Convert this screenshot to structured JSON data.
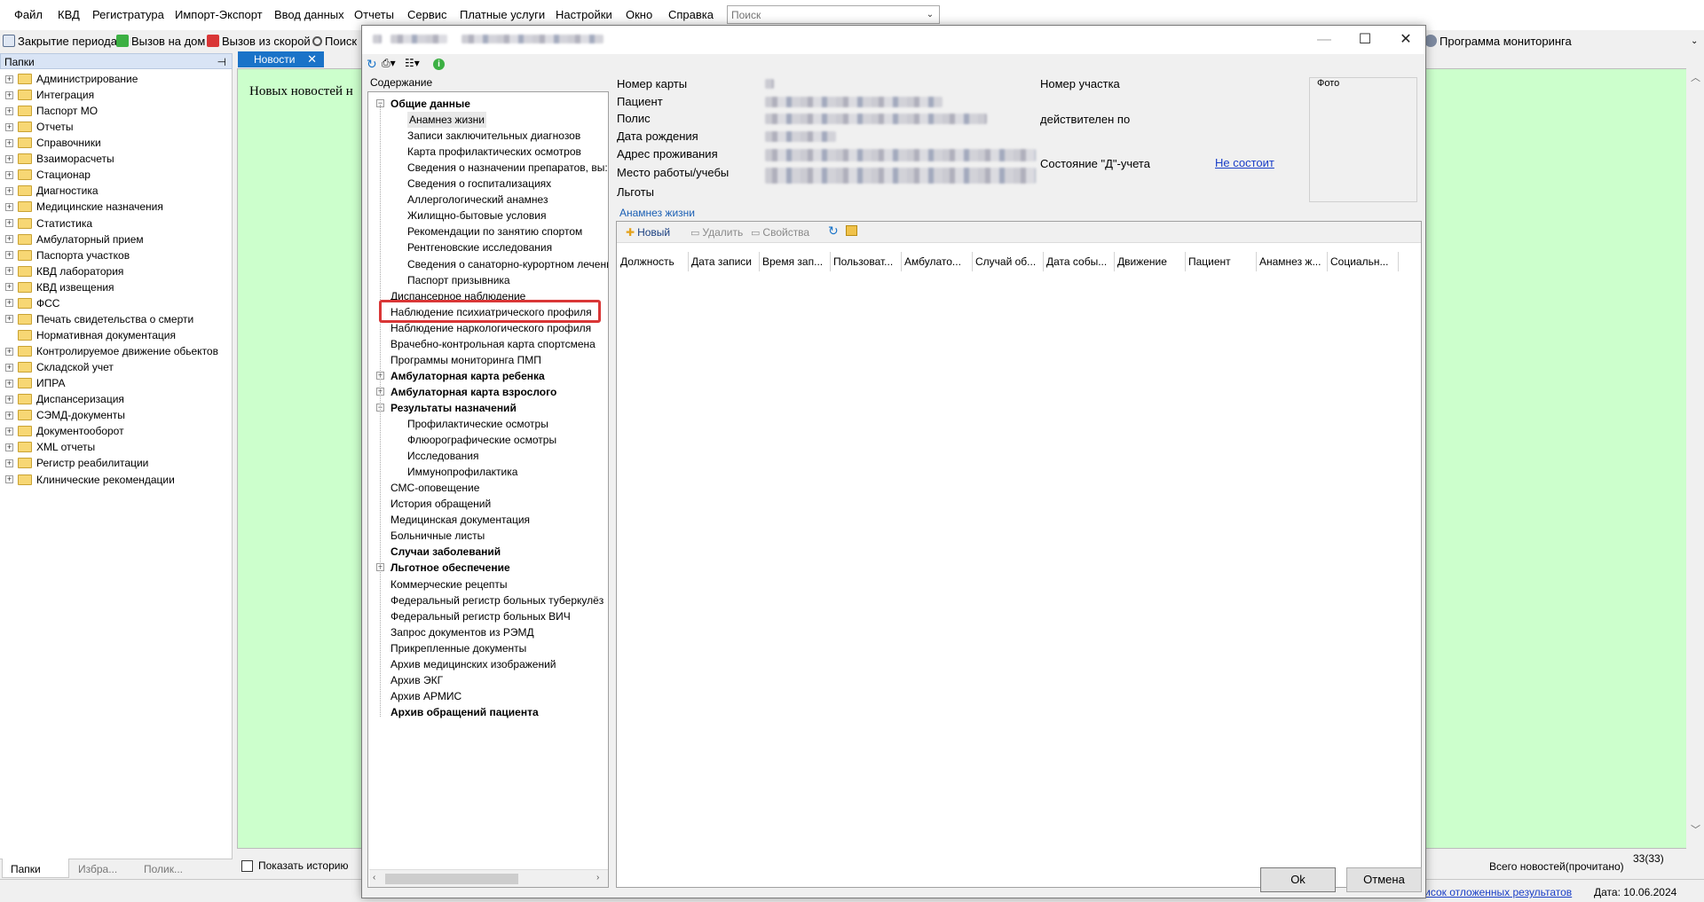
{
  "main_menu": [
    "Файл",
    "КВД",
    "Регистратура",
    "Импорт-Экспорт",
    "Ввод данных",
    "Отчеты",
    "Сервис",
    "Платные услуги",
    "Настройки",
    "Окно",
    "Справка"
  ],
  "search": {
    "placeholder": "Поиск"
  },
  "toolbar": {
    "close_period": "Закрытие периода",
    "home_call": "Вызов на дом",
    "ambulance_call": "Вызов из скорой",
    "search": "Поиск",
    "monitoring_program": "Программа мониторинга"
  },
  "folders": {
    "title": "Папки",
    "items": [
      "Администрирование",
      "Интеграция",
      "Паспорт МО",
      "Отчеты",
      "Справочники",
      "Взаиморасчеты",
      "Стационар",
      "Диагностика",
      "Медицинские назначения",
      "Статистика",
      "Амбулаторный прием",
      "Паспорта участков",
      "КВД лаборатория",
      "КВД извещения",
      "ФСС",
      "Печать свидетельства о смерти",
      "Нормативная документация",
      "Контролируемое движение обьектов",
      "Складской учет",
      "ИПРА",
      "Диспансеризация",
      "СЭМД-документы",
      "Документооборот",
      "XML отчеты",
      "Регистр реабилитации",
      "Клинические рекомендации"
    ]
  },
  "left_tabs": [
    "Папки",
    "Избра...",
    "Полик..."
  ],
  "news": {
    "tab": "Новости",
    "message": "Новых новостей н",
    "show_history": "Показать историю",
    "total": "Всего новостей(прочитано)",
    "count": "33(33)"
  },
  "status": {
    "deferred": "Список отложенных результатов",
    "date": "Дата: 10.06.2024"
  },
  "dialog": {
    "contents_label": "Содержание",
    "tree": [
      {
        "label": "Общие данные",
        "bold": true,
        "level": 0,
        "exp": "−"
      },
      {
        "label": "Анамнез жизни",
        "level": 1,
        "selected": true
      },
      {
        "label": "Записи заключительных диагнозов",
        "level": 1
      },
      {
        "label": "Карта профилактических осмотров",
        "level": 1
      },
      {
        "label": "Сведения о назначении препаратов, вы:",
        "level": 1
      },
      {
        "label": "Сведения о госпитализациях",
        "level": 1
      },
      {
        "label": "Аллергологический анамнез",
        "level": 1
      },
      {
        "label": "Жилищно-бытовые условия",
        "level": 1
      },
      {
        "label": "Рекомендации по занятию спортом",
        "level": 1
      },
      {
        "label": "Рентгеновские исследования",
        "level": 1
      },
      {
        "label": "Сведения о санаторно-курортном лечени",
        "level": 1
      },
      {
        "label": "Паспорт призывника",
        "level": 1
      },
      {
        "label": "Диспансерное наблюдение",
        "level": 0
      },
      {
        "label": "Наблюдение психиатрического профиля",
        "level": 0,
        "highlighted": true
      },
      {
        "label": "Наблюдение наркологического профиля",
        "level": 0
      },
      {
        "label": "Врачебно-контрольная карта спортсмена",
        "level": 0
      },
      {
        "label": "Программы мониторинга ПМП",
        "level": 0
      },
      {
        "label": "Амбулаторная карта ребенка",
        "bold": true,
        "level": 0,
        "exp": "+"
      },
      {
        "label": "Амбулаторная карта взрослого",
        "bold": true,
        "level": 0,
        "exp": "+"
      },
      {
        "label": "Результаты назначений",
        "bold": true,
        "level": 0,
        "exp": "−"
      },
      {
        "label": "Профилактические осмотры",
        "level": 1
      },
      {
        "label": "Флюорографические осмотры",
        "level": 1
      },
      {
        "label": "Исследования",
        "level": 1
      },
      {
        "label": "Иммунопрофилактика",
        "level": 1
      },
      {
        "label": "СМС-оповещение",
        "level": 0
      },
      {
        "label": "История обращений",
        "level": 0
      },
      {
        "label": "Медицинская документация",
        "level": 0
      },
      {
        "label": "Больничные листы",
        "level": 0
      },
      {
        "label": "Случаи заболеваний",
        "bold": true,
        "level": 0
      },
      {
        "label": "Льготное обеспечение",
        "bold": true,
        "level": 0,
        "exp": "+"
      },
      {
        "label": "Коммерческие рецепты",
        "level": 0
      },
      {
        "label": "Федеральный регистр больных туберкулёз",
        "level": 0
      },
      {
        "label": "Федеральный регистр больных ВИЧ",
        "level": 0
      },
      {
        "label": "Запрос документов из РЭМД",
        "level": 0
      },
      {
        "label": "Прикрепленные документы",
        "level": 0
      },
      {
        "label": "Архив медицинских изображений",
        "level": 0
      },
      {
        "label": "Архив ЭКГ",
        "level": 0
      },
      {
        "label": "Архив АРМИС",
        "level": 0
      },
      {
        "label": "Архив обращений пациента",
        "bold": true,
        "level": 0
      }
    ],
    "patient": {
      "card_number": "Номер карты",
      "patient": "Пациент",
      "policy": "Полис",
      "birth_date": "Дата рождения",
      "address": "Адрес проживания",
      "work": "Место работы/учебы",
      "benefits": "Льготы",
      "district_number": "Номер участка",
      "valid_until": "действителен по",
      "d_status_label": "Состояние \"Д\"-учета",
      "d_status_value": "Не состоит",
      "photo": "Фото"
    },
    "section": "Анамнез жизни",
    "grid_toolbar": {
      "new": "Новый",
      "delete": "Удалить",
      "properties": "Свойства"
    },
    "columns": [
      "Должность",
      "Дата записи",
      "Время зап...",
      "Пользоват...",
      "Амбулато...",
      "Случай об...",
      "Дата собы...",
      "Движение",
      "Пациент",
      "Анамнез ж...",
      "Социальн..."
    ],
    "ok": "Ok",
    "cancel": "Отмена"
  },
  "colors": {
    "accent": "#1a73c8",
    "news_bg": "#ccffcc",
    "highlight": "#d93636",
    "link": "#1a3fc8"
  }
}
